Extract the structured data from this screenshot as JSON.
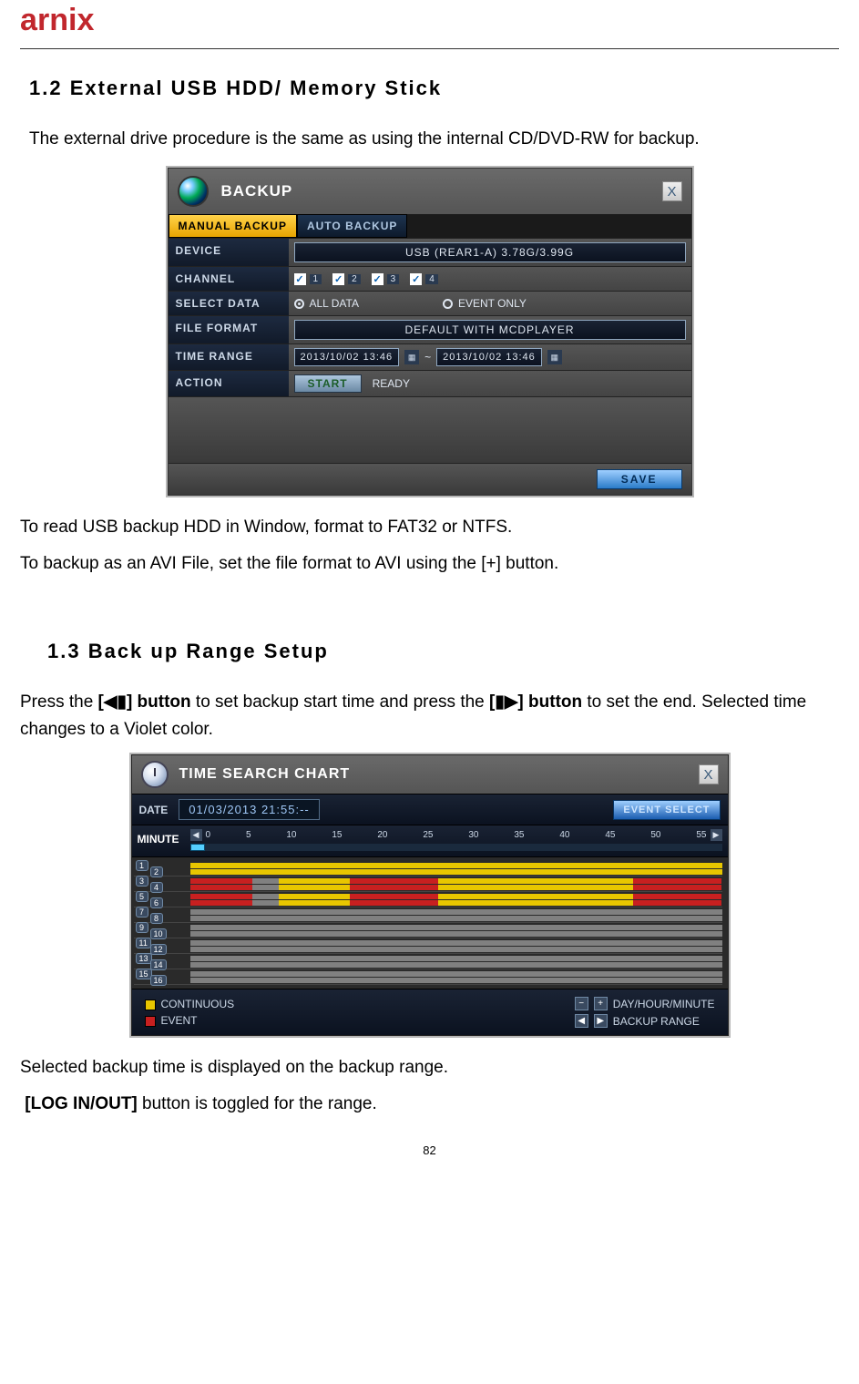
{
  "header": {
    "logo_text": "arnix"
  },
  "section12": {
    "heading": "1.2  External  USB  HDD/  Memory  Stick",
    "intro": "The external drive procedure is the same as using the internal CD/DVD-RW for backup.",
    "note1": "To read USB backup HDD in Window, format to FAT32 or NTFS.",
    "note2": "To backup as an AVI File, set the file format to AVI using the [+] button."
  },
  "backup_dialog": {
    "title": "BACKUP",
    "tabs": {
      "active": "MANUAL BACKUP",
      "inactive": "AUTO BACKUP"
    },
    "rows": {
      "device": {
        "label": "DEVICE",
        "value": "USB (REAR1-A) 3.78G/3.99G"
      },
      "channel": {
        "label": "CHANNEL",
        "items": [
          "1",
          "2",
          "3",
          "4"
        ]
      },
      "select_data": {
        "label": "SELECT DATA",
        "opt_all": "ALL DATA",
        "opt_event": "EVENT ONLY"
      },
      "file_format": {
        "label": "FILE FORMAT",
        "value": "DEFAULT WITH MCDPLAYER"
      },
      "time_range": {
        "label": "TIME RANGE",
        "from": "2013/10/02 13:46",
        "to": "2013/10/02 13:46",
        "sep": "~"
      },
      "action": {
        "label": "ACTION",
        "start": "START",
        "ready": "READY"
      }
    },
    "save": "SAVE"
  },
  "section13": {
    "heading": "1.3  Back  up  Range  Setup",
    "para_pre": "Press the ",
    "btn_left": "[◀▮] button",
    "para_mid": " to set backup start time and press the ",
    "btn_right": "[▮▶] button",
    "para_post": " to set the end. Selected time changes to a Violet color.",
    "tail1": "Selected backup time is displayed on the backup range.",
    "tail2_a": "[LOG IN/OUT]",
    "tail2_b": " button is toggled for the range."
  },
  "timesearch_dialog": {
    "title": "TIME SEARCH CHART",
    "date_label": "DATE",
    "date_value": "01/03/2013 21:55:--",
    "event_select": "EVENT SELECT",
    "minute_label": "MINUTE",
    "minute_ticks": [
      "0",
      "5",
      "10",
      "15",
      "20",
      "25",
      "30",
      "35",
      "40",
      "45",
      "50",
      "55"
    ],
    "legend_continuous": "CONTINUOUS",
    "legend_event": "EVENT",
    "legend_dayhm": "DAY/HOUR/MINUTE",
    "legend_range": "BACKUP RANGE"
  },
  "chart_data": {
    "type": "table",
    "unit_label": "MINUTE",
    "ticks": [
      0,
      5,
      10,
      15,
      20,
      25,
      30,
      35,
      40,
      45,
      50,
      55
    ],
    "channels": [
      1,
      2,
      3,
      4,
      5,
      6,
      7,
      8,
      9,
      10,
      11,
      12,
      13,
      14,
      15,
      16
    ],
    "segments_per_channel": {
      "1": [
        {
          "type": "continuous",
          "from": 0,
          "to": 60
        }
      ],
      "2": [
        {
          "type": "continuous",
          "from": 0,
          "to": 60
        }
      ],
      "3": [
        {
          "type": "event",
          "from": 0,
          "to": 7
        },
        {
          "type": "gap",
          "from": 7,
          "to": 10
        },
        {
          "type": "continuous",
          "from": 10,
          "to": 18
        },
        {
          "type": "event",
          "from": 18,
          "to": 28
        },
        {
          "type": "continuous",
          "from": 28,
          "to": 50
        },
        {
          "type": "event",
          "from": 50,
          "to": 60
        }
      ],
      "4": [
        {
          "type": "event",
          "from": 0,
          "to": 7
        },
        {
          "type": "gap",
          "from": 7,
          "to": 10
        },
        {
          "type": "continuous",
          "from": 10,
          "to": 18
        },
        {
          "type": "event",
          "from": 18,
          "to": 28
        },
        {
          "type": "continuous",
          "from": 28,
          "to": 50
        },
        {
          "type": "event",
          "from": 50,
          "to": 60
        }
      ],
      "5": [
        {
          "type": "event",
          "from": 0,
          "to": 7
        },
        {
          "type": "gap",
          "from": 7,
          "to": 10
        },
        {
          "type": "continuous",
          "from": 10,
          "to": 18
        },
        {
          "type": "event",
          "from": 18,
          "to": 28
        },
        {
          "type": "continuous",
          "from": 28,
          "to": 50
        },
        {
          "type": "event",
          "from": 50,
          "to": 60
        }
      ],
      "6": [
        {
          "type": "event",
          "from": 0,
          "to": 7
        },
        {
          "type": "gap",
          "from": 7,
          "to": 10
        },
        {
          "type": "continuous",
          "from": 10,
          "to": 18
        },
        {
          "type": "event",
          "from": 18,
          "to": 28
        },
        {
          "type": "continuous",
          "from": 28,
          "to": 50
        },
        {
          "type": "event",
          "from": 50,
          "to": 60
        }
      ],
      "7": [
        {
          "type": "gap",
          "from": 0,
          "to": 60
        }
      ],
      "8": [
        {
          "type": "gap",
          "from": 0,
          "to": 60
        }
      ],
      "9": [
        {
          "type": "gap",
          "from": 0,
          "to": 60
        }
      ],
      "10": [
        {
          "type": "gap",
          "from": 0,
          "to": 60
        }
      ],
      "11": [
        {
          "type": "gap",
          "from": 0,
          "to": 60
        }
      ],
      "12": [
        {
          "type": "gap",
          "from": 0,
          "to": 60
        }
      ],
      "13": [
        {
          "type": "gap",
          "from": 0,
          "to": 60
        }
      ],
      "14": [
        {
          "type": "gap",
          "from": 0,
          "to": 60
        }
      ],
      "15": [
        {
          "type": "gap",
          "from": 0,
          "to": 60
        }
      ],
      "16": [
        {
          "type": "gap",
          "from": 0,
          "to": 60
        }
      ]
    },
    "legend": {
      "continuous": "yellow",
      "event": "red",
      "gap": "gray"
    }
  },
  "page_number": "82"
}
